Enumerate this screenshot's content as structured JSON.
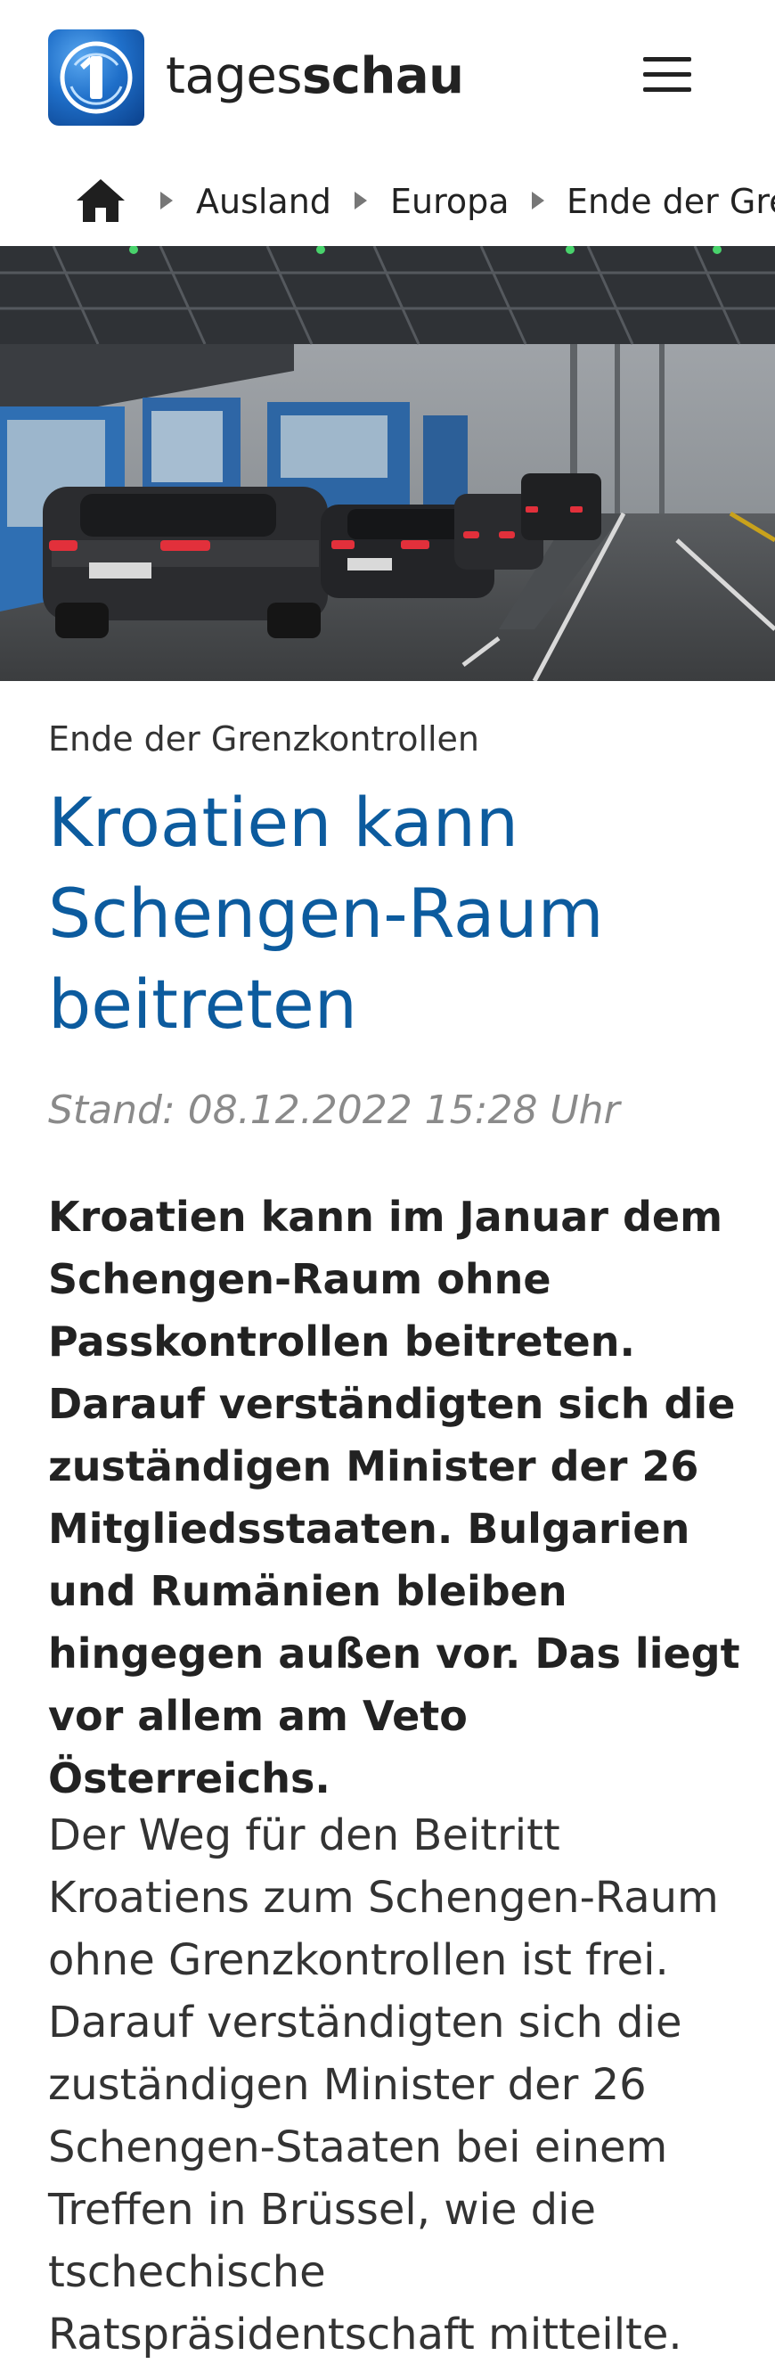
{
  "header": {
    "brand_light": "tages",
    "brand_bold": "schau",
    "logo_icon": "tagesschau-logo",
    "menu_icon": "hamburger-menu-icon"
  },
  "breadcrumb": {
    "home_icon": "home-icon",
    "items": [
      "Ausland",
      "Europa",
      "Ende der Gre"
    ]
  },
  "hero": {
    "subject": "hero-image"
  },
  "article": {
    "kicker": "Ende der Grenzkontrollen",
    "headline": "Kroatien kann Schengen-Raum beitreten",
    "stand": "Stand: 08.12.2022 15:28 Uhr",
    "teaser": "Kroatien kann im Januar dem Schengen-Raum ohne Passkontrollen beitreten. Darauf verständigten sich die zuständigen Minister der 26 Mitgliedsstaaten. Bulgarien und Rumänien bleiben hingegen außen vor. Das liegt vor allem am Veto Österreichs.",
    "paragraph": "Der Weg für den Beitritt Kroatiens zum Schengen-Raum ohne Grenzkontrollen ist frei. Darauf verständigten sich die zuständigen Minister der 26 Schengen-Staaten bei einem Treffen in Brüssel, wie die tschechische Ratspräsidentschaft mitteilte."
  },
  "colors": {
    "headline": "#0c5b9e",
    "stand": "#8a8a8a",
    "logo": "#1f6fc9"
  }
}
